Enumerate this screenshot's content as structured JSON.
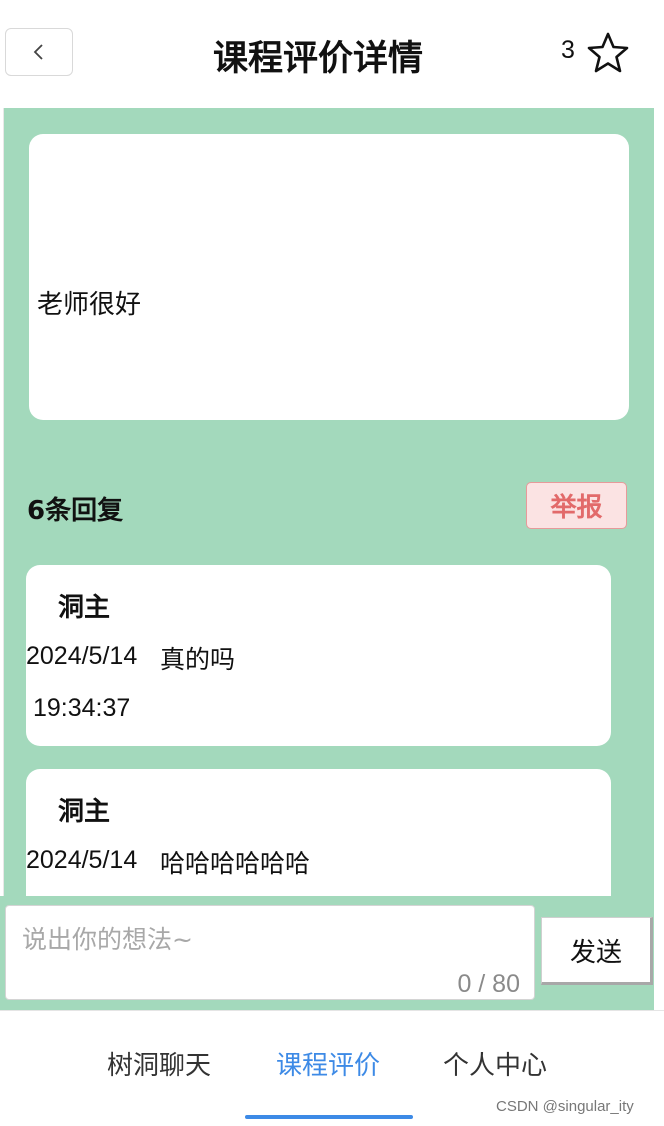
{
  "header": {
    "title": "课程评价详情",
    "star_count": "3",
    "back_icon": "chevron-left-icon",
    "star_icon": "star-outline-icon"
  },
  "review": {
    "content": "老师很好"
  },
  "replies": {
    "count_label": "6条回复",
    "report_label": "举报",
    "items": [
      {
        "author": "洞主",
        "date": "2024/5/14",
        "time": "19:34:37",
        "content": "真的吗"
      },
      {
        "author": "洞主",
        "date": "2024/5/14",
        "content": "哈哈哈哈哈哈"
      }
    ]
  },
  "input": {
    "placeholder": "说出你的想法~",
    "counter": "0 / 80",
    "send_label": "发送"
  },
  "tabbar": {
    "tabs": [
      {
        "label": "树洞聊天"
      },
      {
        "label": "课程评价",
        "active": true
      },
      {
        "label": "个人中心"
      }
    ]
  },
  "watermark": "CSDN @singular_ity",
  "colors": {
    "green_bg": "#a3d9bc",
    "accent_blue": "#3d8ae6",
    "report_red": "#e26a6a"
  }
}
